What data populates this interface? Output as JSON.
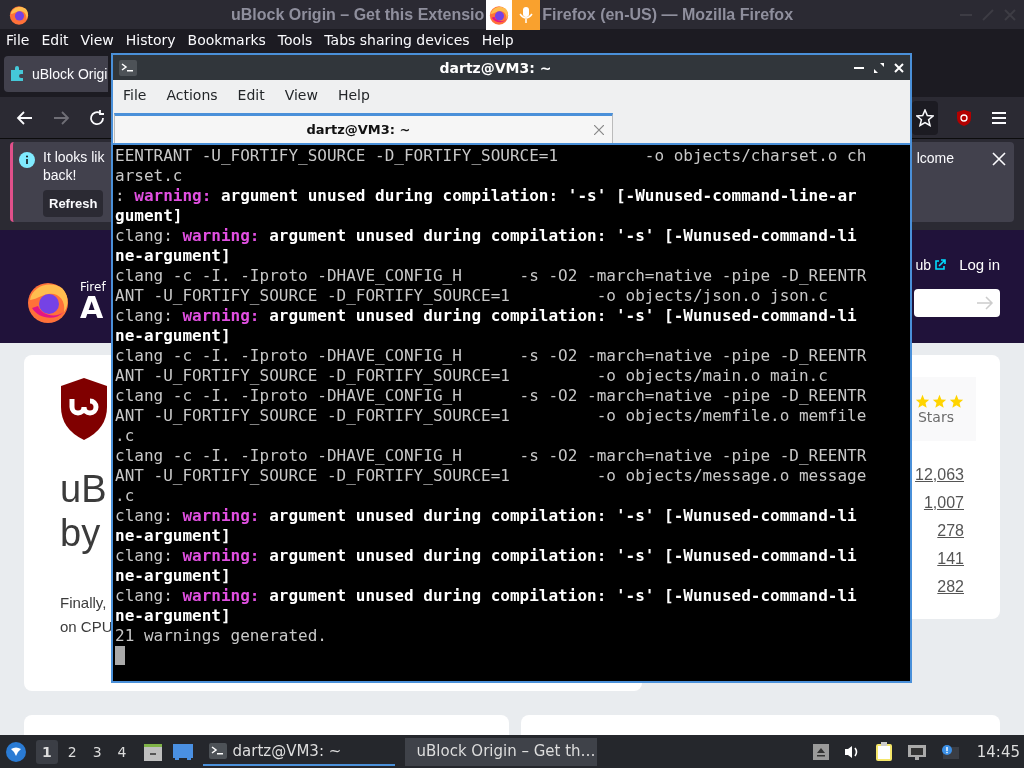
{
  "firefox": {
    "title_start": "uBlock Origin – Get this Extensio",
    "title_end": "Firefox (en-US) — Mozilla Firefox",
    "menu": [
      "File",
      "Edit",
      "View",
      "History",
      "Bookmarks",
      "Tools",
      "Tabs sharing devices",
      "Help"
    ],
    "tabs": [
      {
        "label": "uBlock Origi",
        "selected": true
      }
    ],
    "notification": {
      "text_lines": [
        "It looks lik",
        "back!"
      ],
      "button": "Refresh",
      "right_text": "lcome"
    },
    "page": {
      "header": {
        "brand_small": "Firef",
        "brand_large": "A",
        "link": "ub",
        "login": "Log in"
      },
      "addon": {
        "name": "uB",
        "author": "by",
        "description": [
          "Finally,",
          "on CPU"
        ]
      },
      "rating": {
        "label": "Stars",
        "counts": [
          "12,063",
          "1,007",
          "278",
          "141",
          "282"
        ]
      }
    }
  },
  "terminal": {
    "title": "dartz@VM3: ~",
    "menu": [
      "File",
      "Actions",
      "Edit",
      "View",
      "Help"
    ],
    "tabs": [
      {
        "label": "dartz@VM3: ~",
        "selected": true
      }
    ],
    "lines": [
      [
        {
          "kind": "plain",
          "text": "EENTRANT -U_FORTIFY_SOURCE -D_FORTIFY_SOURCE=1         -o objects/charset.o ch"
        }
      ],
      [
        {
          "kind": "plain",
          "text": "arset.c"
        }
      ],
      [
        {
          "kind": "plain",
          "text": ": "
        },
        {
          "kind": "warning",
          "text": "warning:"
        },
        {
          "kind": "bold",
          "text": " argument unused during compilation: '-s' [-Wunused-command-line-ar"
        }
      ],
      [
        {
          "kind": "bold",
          "text": "gument]"
        }
      ],
      [
        {
          "kind": "plain",
          "text": "clang: "
        },
        {
          "kind": "warning",
          "text": "warning:"
        },
        {
          "kind": "bold",
          "text": " argument unused during compilation: '-s' [-Wunused-command-li"
        }
      ],
      [
        {
          "kind": "bold",
          "text": "ne-argument]"
        }
      ],
      [
        {
          "kind": "plain",
          "text": "clang -c -I. -Iproto -DHAVE_CONFIG_H      -s -O2 -march=native -pipe -D_REENTR"
        }
      ],
      [
        {
          "kind": "plain",
          "text": "ANT -U_FORTIFY_SOURCE -D_FORTIFY_SOURCE=1         -o objects/json.o json.c"
        }
      ],
      [
        {
          "kind": "plain",
          "text": "clang: "
        },
        {
          "kind": "warning",
          "text": "warning:"
        },
        {
          "kind": "bold",
          "text": " argument unused during compilation: '-s' [-Wunused-command-li"
        }
      ],
      [
        {
          "kind": "bold",
          "text": "ne-argument]"
        }
      ],
      [
        {
          "kind": "plain",
          "text": "clang -c -I. -Iproto -DHAVE_CONFIG_H      -s -O2 -march=native -pipe -D_REENTR"
        }
      ],
      [
        {
          "kind": "plain",
          "text": "ANT -U_FORTIFY_SOURCE -D_FORTIFY_SOURCE=1         -o objects/main.o main.c"
        }
      ],
      [
        {
          "kind": "plain",
          "text": "clang -c -I. -Iproto -DHAVE_CONFIG_H      -s -O2 -march=native -pipe -D_REENTR"
        }
      ],
      [
        {
          "kind": "plain",
          "text": "ANT -U_FORTIFY_SOURCE -D_FORTIFY_SOURCE=1         -o objects/memfile.o memfile"
        }
      ],
      [
        {
          "kind": "plain",
          "text": ".c"
        }
      ],
      [
        {
          "kind": "plain",
          "text": "clang -c -I. -Iproto -DHAVE_CONFIG_H      -s -O2 -march=native -pipe -D_REENTR"
        }
      ],
      [
        {
          "kind": "plain",
          "text": "ANT -U_FORTIFY_SOURCE -D_FORTIFY_SOURCE=1         -o objects/message.o message"
        }
      ],
      [
        {
          "kind": "plain",
          "text": ".c"
        }
      ],
      [
        {
          "kind": "plain",
          "text": "clang: "
        },
        {
          "kind": "warning",
          "text": "warning:"
        },
        {
          "kind": "bold",
          "text": " argument unused during compilation: '-s' [-Wunused-command-li"
        }
      ],
      [
        {
          "kind": "bold",
          "text": "ne-argument]"
        }
      ],
      [
        {
          "kind": "plain",
          "text": "clang: "
        },
        {
          "kind": "warning",
          "text": "warning:"
        },
        {
          "kind": "bold",
          "text": " argument unused during compilation: '-s' [-Wunused-command-li"
        }
      ],
      [
        {
          "kind": "bold",
          "text": "ne-argument]"
        }
      ],
      [
        {
          "kind": "plain",
          "text": "clang: "
        },
        {
          "kind": "warning",
          "text": "warning:"
        },
        {
          "kind": "bold",
          "text": " argument unused during compilation: '-s' [-Wunused-command-li"
        }
      ],
      [
        {
          "kind": "bold",
          "text": "ne-argument]"
        }
      ],
      [
        {
          "kind": "plain",
          "text": "21 warnings generated."
        }
      ]
    ]
  },
  "taskbar": {
    "workspaces": [
      {
        "label": "1",
        "selected": true
      },
      {
        "label": "2",
        "selected": false
      },
      {
        "label": "3",
        "selected": false
      },
      {
        "label": "4",
        "selected": false
      }
    ],
    "tasks": [
      {
        "label": "dartz@VM3: ~",
        "kind": "terminal",
        "selected": true
      },
      {
        "label": "uBlock Origin – Get th…",
        "kind": "browser",
        "selected": false
      }
    ],
    "clock": "14:45"
  }
}
